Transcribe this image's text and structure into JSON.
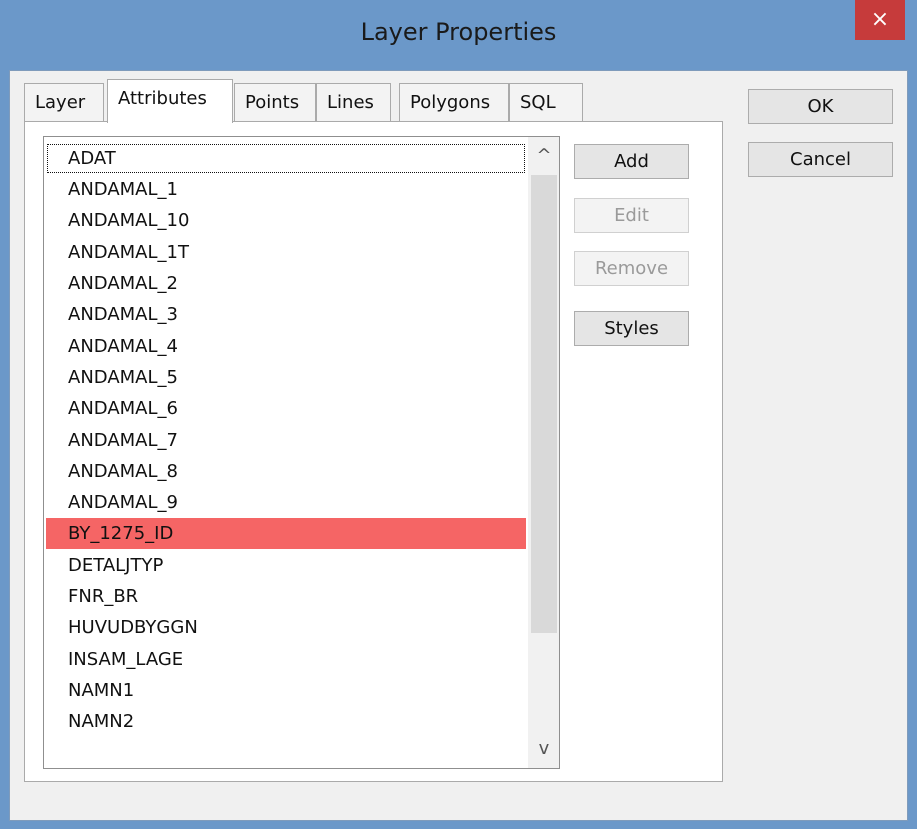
{
  "window": {
    "title": "Layer Properties",
    "close_label": "×"
  },
  "tabs": [
    "Layer",
    "Attributes",
    "Points",
    "Lines",
    "Polygons",
    "SQL"
  ],
  "active_tab": "Attributes",
  "attributes": {
    "items": [
      "ADAT",
      "ANDAMAL_1",
      "ANDAMAL_10",
      "ANDAMAL_1T",
      "ANDAMAL_2",
      "ANDAMAL_3",
      "ANDAMAL_4",
      "ANDAMAL_5",
      "ANDAMAL_6",
      "ANDAMAL_7",
      "ANDAMAL_8",
      "ANDAMAL_9",
      "BY_1275_ID",
      "DETALJTYP",
      "FNR_BR",
      "HUVUDBYGGN",
      "INSAM_LAGE",
      "NAMN1",
      "NAMN2"
    ],
    "selected": "BY_1275_ID",
    "focused": "ADAT"
  },
  "scrollbar": {
    "up_icon": "^",
    "down_icon": "v"
  },
  "buttons": {
    "add": "Add",
    "edit": "Edit",
    "remove": "Remove",
    "styles": "Styles",
    "ok": "OK",
    "cancel": "Cancel"
  },
  "colors": {
    "titlebar": "#6b98c9",
    "close": "#c63b3b",
    "selection": "#f56565"
  }
}
